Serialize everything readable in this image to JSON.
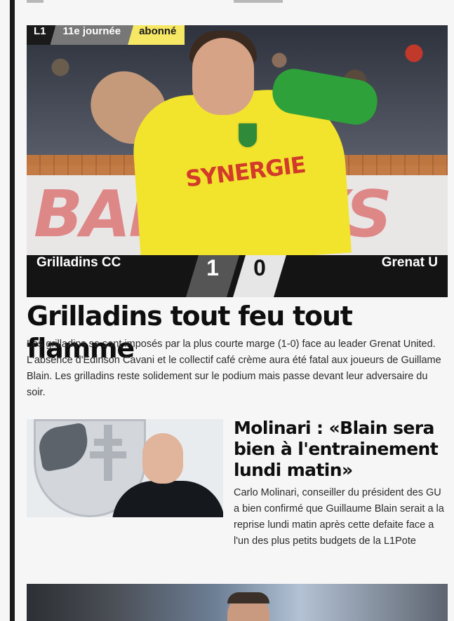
{
  "hero_article": {
    "tags": {
      "league": "L1",
      "matchday": "11e journée",
      "access": "abonné"
    },
    "image": {
      "sponsor_text": "SYNERGIE",
      "board_text": "BARCLAYS"
    },
    "match": {
      "home_team": "Grilladins CC",
      "home_score": "1",
      "away_score": "0",
      "away_team": "Grenat U"
    },
    "headline": "Grilladins tout feu tout flamme",
    "summary": "Les grilladins se sont imposés par la plus courte marge (1-0) face au leader Grenat United. L'absence d'Edinson Cavani et le collectif café crème aura été fatal aux joueurs de Guillame Blain. Les grilladins reste solidement sur le podium mais passe devant leur adversaire du soir."
  },
  "second_article": {
    "title": "Molinari : «Blain sera bien à l'entrainement lundi matin»",
    "summary": "Carlo Molinari, conseiller du président des GU a bien confirmé que Guillaume Blain serait a la reprise lundi matin après cette defaite face a l'un des plus petits budgets de la L1Pote"
  },
  "colors": {
    "accent_yellow": "#f6e764",
    "dark": "#141414",
    "tag_grey": "#777777"
  },
  "icons": {
    "crest": "club-crest-icon"
  }
}
